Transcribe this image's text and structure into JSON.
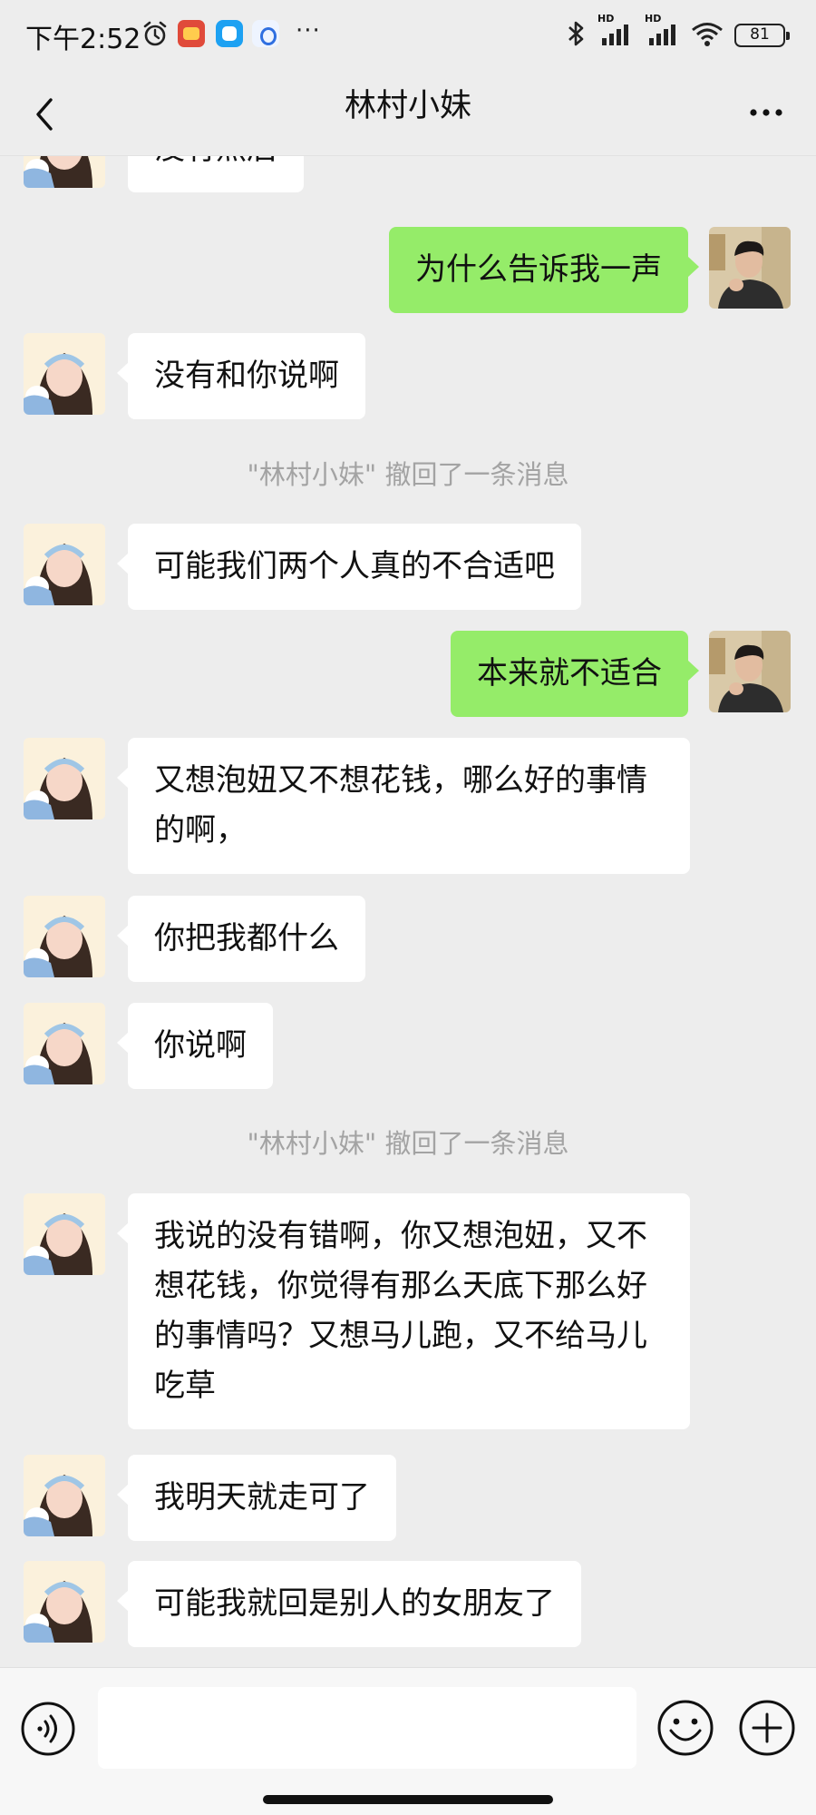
{
  "status_bar": {
    "time": "下午2:52",
    "network_label": "HD",
    "battery": "81",
    "icons": [
      "alarm-icon",
      "app-icon",
      "app-icon",
      "app-icon",
      "more-dots-icon",
      "bluetooth-icon",
      "signal-icon",
      "signal-icon",
      "wifi-icon",
      "battery-icon"
    ]
  },
  "header": {
    "title": "林村小妹",
    "back_icon": "chevron-left-icon",
    "menu_icon": "more-horizontal-icon"
  },
  "messages": [
    {
      "type": "text",
      "side": "in",
      "text": "没有然后"
    },
    {
      "type": "text",
      "side": "out",
      "text": "为什么告诉我一声"
    },
    {
      "type": "text",
      "side": "in",
      "text": "没有和你说啊"
    },
    {
      "type": "system",
      "text": "\"林村小妹\" 撤回了一条消息"
    },
    {
      "type": "text",
      "side": "in",
      "text": "可能我们两个人真的不合适吧"
    },
    {
      "type": "text",
      "side": "out",
      "text": "本来就不适合"
    },
    {
      "type": "text",
      "side": "in",
      "text": "又想泡妞又不想花钱，哪么好的事情的啊，"
    },
    {
      "type": "text",
      "side": "in",
      "text": "你把我都什么"
    },
    {
      "type": "text",
      "side": "in",
      "text": "你说啊"
    },
    {
      "type": "system",
      "text": "\"林村小妹\" 撤回了一条消息"
    },
    {
      "type": "text",
      "side": "in",
      "text": "我说的没有错啊，你又想泡妞，又不想花钱，你觉得有那么天底下那么好的事情吗？又想马儿跑，又不给马儿吃草"
    },
    {
      "type": "text",
      "side": "in",
      "text": "我明天就走可了"
    },
    {
      "type": "text",
      "side": "in",
      "text": "可能我就回是别人的女朋友了"
    }
  ],
  "input_bar": {
    "placeholder": "",
    "voice_icon": "voice-icon",
    "emoji_icon": "emoji-icon",
    "add_icon": "plus-circle-icon"
  },
  "colors": {
    "background": "#ededed",
    "incoming_bubble": "#ffffff",
    "outgoing_bubble": "#95ec69",
    "system_text": "#a3a3a3"
  }
}
